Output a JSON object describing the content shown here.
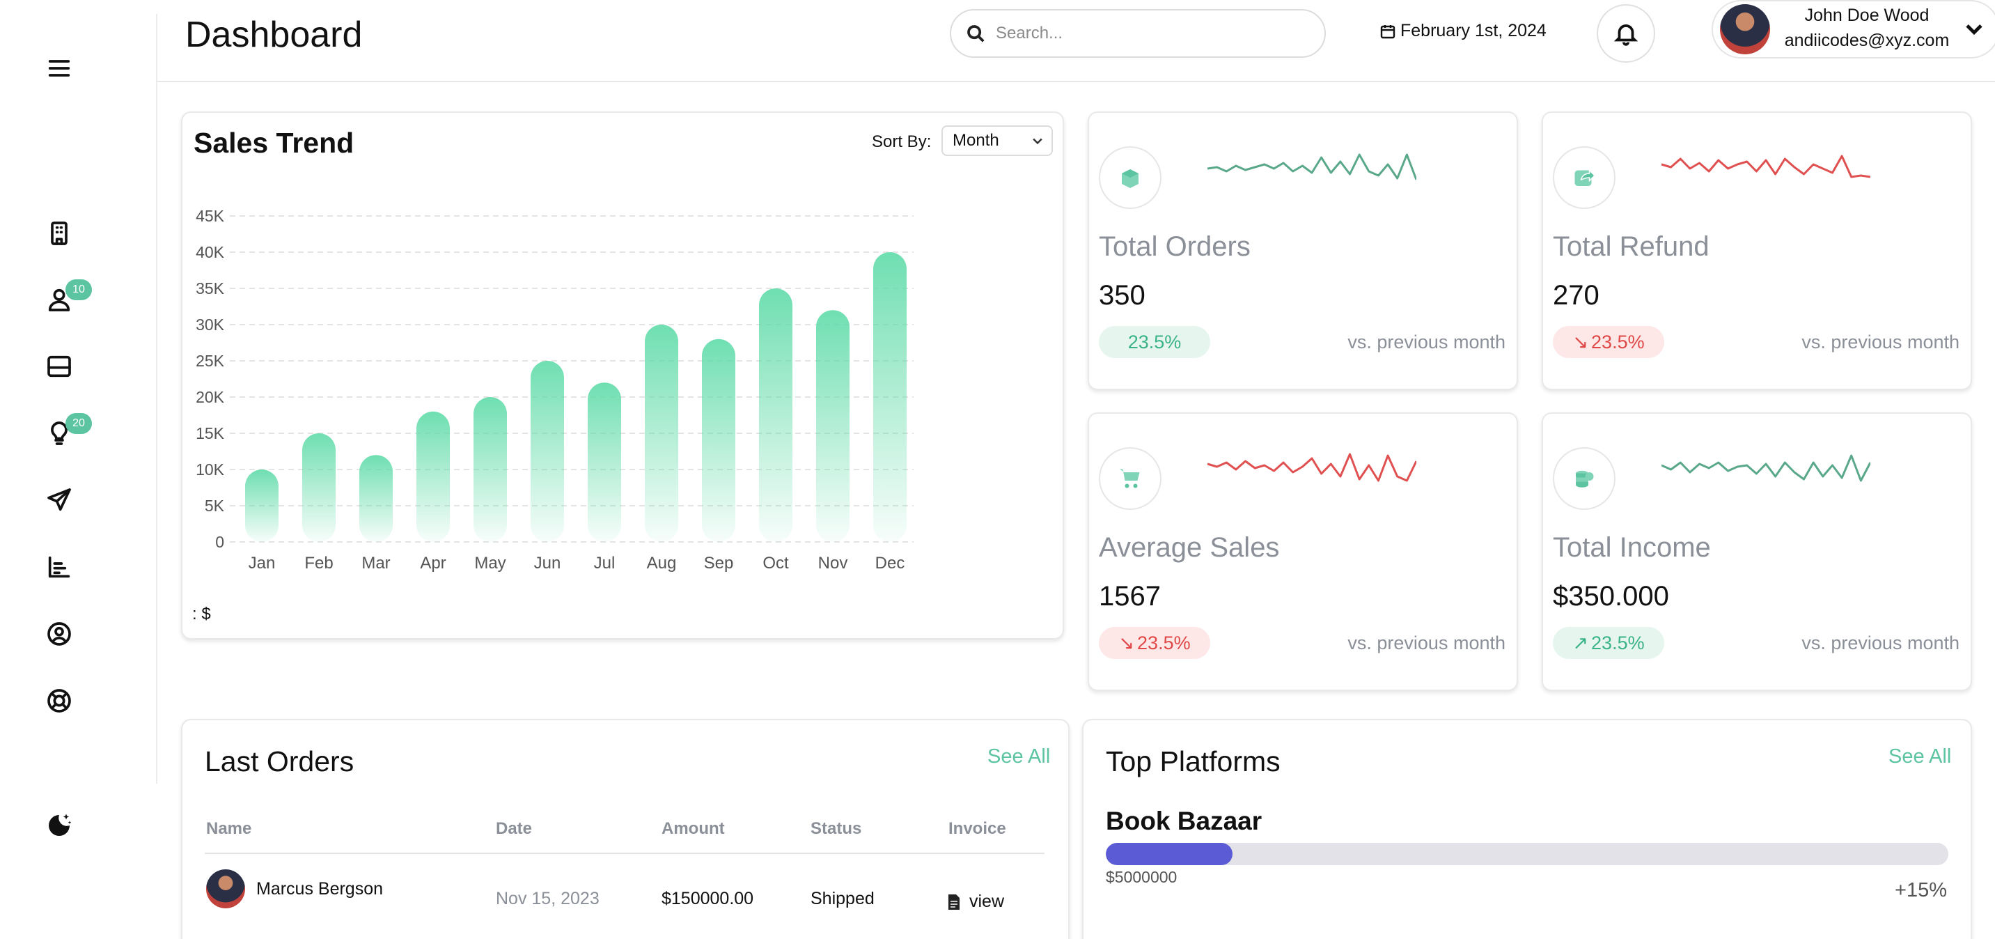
{
  "sidebar": {
    "menu_icon": "hamburger-menu-icon",
    "items": [
      {
        "name": "building-icon",
        "badge": ""
      },
      {
        "name": "user-icon",
        "badge": "10"
      },
      {
        "name": "inbox-icon",
        "badge": ""
      },
      {
        "name": "lightbulb-icon",
        "badge": "20"
      },
      {
        "name": "send-icon",
        "badge": ""
      },
      {
        "name": "bar-chart-icon",
        "badge": ""
      },
      {
        "name": "user-circle-icon",
        "badge": ""
      },
      {
        "name": "lifebuoy-icon",
        "badge": ""
      }
    ],
    "theme_icon": "moon-stars-icon"
  },
  "header": {
    "title": "Dashboard",
    "search_placeholder": "Search...",
    "date": "February 1st, 2024",
    "user_name": "John Doe Wood",
    "user_email": "andiicodes@xyz.com"
  },
  "sales": {
    "title": "Sales Trend",
    "sort_label": "Sort By:",
    "sort_value": "Month",
    "note": ": $"
  },
  "chart_data": {
    "type": "bar",
    "title": "Sales Trend",
    "categories": [
      "Jan",
      "Feb",
      "Mar",
      "Apr",
      "May",
      "Jun",
      "Jul",
      "Aug",
      "Sep",
      "Oct",
      "Nov",
      "Dec"
    ],
    "values": [
      10000,
      15000,
      12000,
      18000,
      20000,
      25000,
      22000,
      30000,
      28000,
      35000,
      32000,
      40000
    ],
    "ylim": [
      0,
      45000
    ],
    "yticks": [
      "0",
      "5K",
      "10K",
      "15K",
      "20K",
      "25K",
      "30K",
      "35K",
      "40K",
      "45K"
    ],
    "grid": true,
    "color": "#5fdba8"
  },
  "stats": [
    {
      "label": "Total Orders",
      "value": "350",
      "change": "23.5%",
      "trend": "neutral",
      "vs": "vs. previous month",
      "icon": "box-icon",
      "spark_color": "#5aa88a"
    },
    {
      "label": "Total Refund",
      "value": "270",
      "change": "23.5%",
      "trend": "down",
      "vs": "vs. previous month",
      "icon": "share-icon",
      "spark_color": "#e05050"
    },
    {
      "label": "Average Sales",
      "value": "1567",
      "change": "23.5%",
      "trend": "down",
      "vs": "vs. previous month",
      "icon": "cart-icon",
      "spark_color": "#e05050"
    },
    {
      "label": "Total Income",
      "value": "$350.000",
      "change": "23.5%",
      "trend": "up",
      "vs": "vs. previous month",
      "icon": "coins-icon",
      "spark_color": "#5aa88a"
    }
  ],
  "orders": {
    "title": "Last Orders",
    "see_all": "See All",
    "columns": [
      "Name",
      "Date",
      "Amount",
      "Status",
      "Invoice"
    ],
    "rows": [
      {
        "name": "Marcus Bergson",
        "date": "Nov 15, 2023",
        "amount": "$150000.00",
        "status": "Shipped",
        "invoice": "view"
      }
    ]
  },
  "platforms": {
    "title": "Top Platforms",
    "see_all": "See All",
    "items": [
      {
        "name": "Book Bazaar",
        "amount": "$5000000",
        "change": "+15%",
        "progress": 0.15,
        "color": "#5b5bd6"
      }
    ]
  }
}
